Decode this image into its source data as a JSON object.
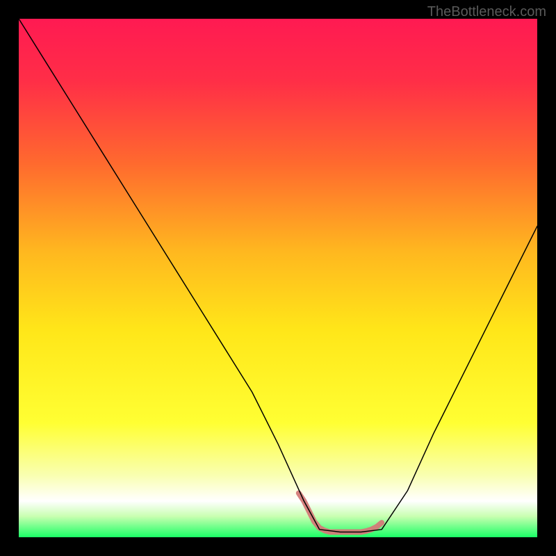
{
  "watermark": "TheBottleneck.com",
  "chart_data": {
    "type": "line",
    "title": "",
    "xlabel": "",
    "ylabel": "",
    "xlim": [
      0,
      100
    ],
    "ylim": [
      0,
      100
    ],
    "background_gradient": {
      "stops": [
        {
          "offset": 0.0,
          "color": "#ff1a52"
        },
        {
          "offset": 0.12,
          "color": "#ff2e47"
        },
        {
          "offset": 0.28,
          "color": "#ff6a2e"
        },
        {
          "offset": 0.45,
          "color": "#ffb81f"
        },
        {
          "offset": 0.6,
          "color": "#ffe619"
        },
        {
          "offset": 0.78,
          "color": "#ffff33"
        },
        {
          "offset": 0.88,
          "color": "#f9ffb0"
        },
        {
          "offset": 0.93,
          "color": "#ffffff"
        },
        {
          "offset": 0.96,
          "color": "#c8ffb0"
        },
        {
          "offset": 1.0,
          "color": "#1aff66"
        }
      ]
    },
    "series": [
      {
        "name": "bottleneck-curve",
        "stroke": "#000000",
        "stroke_width": 1.5,
        "x": [
          0,
          5,
          10,
          15,
          20,
          25,
          30,
          35,
          40,
          45,
          50,
          55,
          58,
          62,
          66,
          70,
          75,
          80,
          85,
          90,
          95,
          100
        ],
        "values": [
          100,
          92,
          84,
          76,
          68,
          60,
          52,
          44,
          36,
          28,
          18,
          7,
          1.5,
          1.0,
          1.0,
          1.5,
          9,
          20,
          30,
          40,
          50,
          60
        ]
      }
    ],
    "markers": {
      "name": "highlight-band",
      "color": "#d47a78",
      "stroke_width": 8,
      "x": [
        54,
        55,
        56,
        57,
        58,
        59,
        60,
        61,
        62,
        63,
        64,
        65,
        66,
        67,
        68,
        69,
        70
      ],
      "values": [
        8.5,
        7.0,
        5.0,
        3.0,
        1.8,
        1.3,
        1.0,
        1.0,
        1.0,
        1.0,
        1.0,
        1.0,
        1.0,
        1.2,
        1.5,
        2.0,
        2.8
      ]
    }
  }
}
